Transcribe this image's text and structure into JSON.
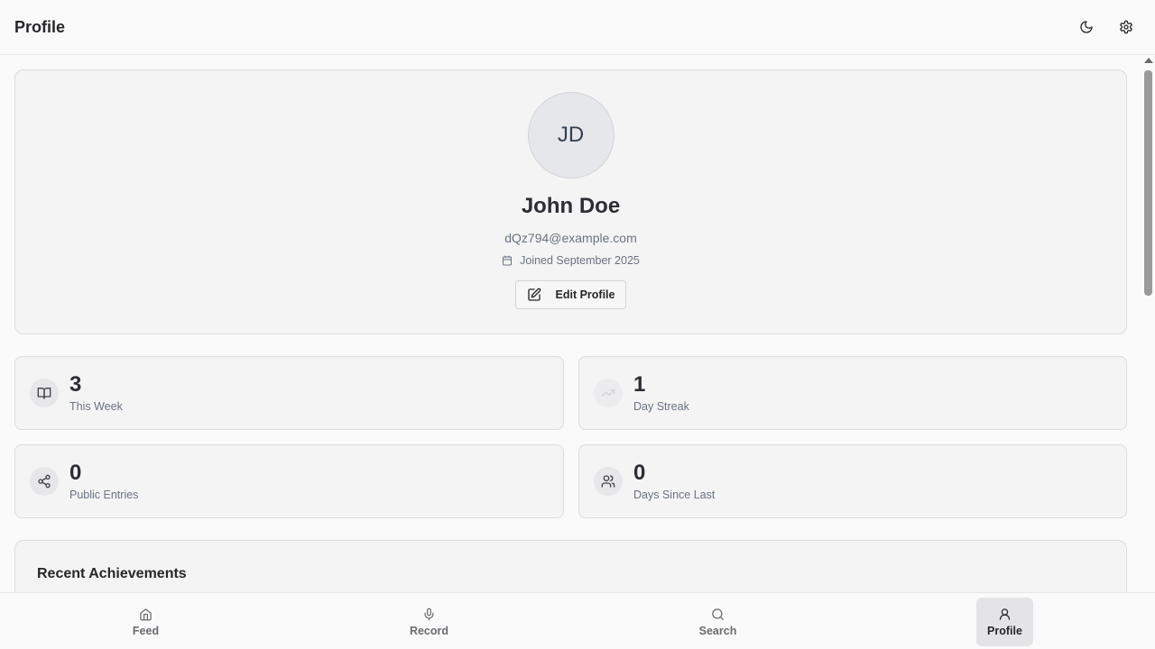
{
  "header": {
    "title": "Profile",
    "theme_icon": "moon-icon",
    "settings_icon": "gear-icon"
  },
  "profile": {
    "initials": "JD",
    "name": "John Doe",
    "email": "dQz794@example.com",
    "joined": "Joined September 2025",
    "edit_label": "Edit Profile"
  },
  "stats": [
    {
      "value": "3",
      "label": "This Week",
      "icon": "book-open-icon"
    },
    {
      "value": "1",
      "label": "Day Streak",
      "icon": "trending-up-icon"
    },
    {
      "value": "0",
      "label": "Public Entries",
      "icon": "share-icon"
    },
    {
      "value": "0",
      "label": "Days Since Last",
      "icon": "users-icon"
    }
  ],
  "achievements": {
    "title": "Recent Achievements"
  },
  "nav": [
    {
      "label": "Feed",
      "icon": "home-icon",
      "active": false
    },
    {
      "label": "Record",
      "icon": "mic-icon",
      "active": false
    },
    {
      "label": "Search",
      "icon": "search-icon",
      "active": false
    },
    {
      "label": "Profile",
      "icon": "user-icon",
      "active": true
    }
  ]
}
